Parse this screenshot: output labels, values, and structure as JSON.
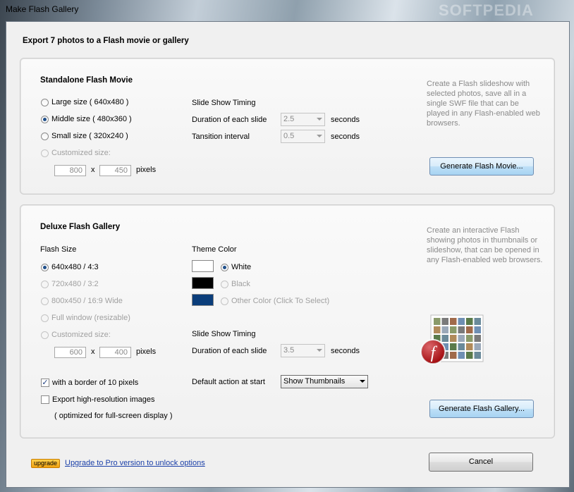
{
  "window": {
    "title": "Make Flash Gallery",
    "watermark": "SOFTPEDIA"
  },
  "header": "Export 7 photos to a Flash movie or gallery",
  "movie": {
    "title": "Standalone Flash Movie",
    "sizes": [
      "Large size ( 640x480 )",
      "Middle size ( 480x360 )",
      "Small size ( 320x240 )",
      "Customized size:"
    ],
    "selected_size": 1,
    "width": "800",
    "height": "450",
    "times_symbol": "x",
    "pixels_label": "pixels",
    "timing_title": "Slide Show Timing",
    "duration_label": "Duration of each slide",
    "duration_value": "2.5",
    "interval_label": "Tansition interval",
    "interval_value": "0.5",
    "seconds_label": "seconds",
    "description": "Create a Flash slideshow with selected photos, save all in a single SWF file that can be played in any Flash-enabled web browsers.",
    "generate_label": "Generate Flash Movie..."
  },
  "gallery": {
    "title": "Deluxe Flash Gallery",
    "size_title": "Flash Size",
    "sizes": [
      "640x480 / 4:3",
      "720x480 / 3:2",
      "800x450 / 16:9 Wide",
      "Full window (resizable)",
      "Customized size:"
    ],
    "selected_size": 0,
    "width": "600",
    "height": "400",
    "times_symbol": "x",
    "pixels_label": "pixels",
    "theme_title": "Theme Color",
    "themes": [
      {
        "label": "White",
        "color": "#ffffff"
      },
      {
        "label": "Black",
        "color": "#000000"
      },
      {
        "label": "Other Color (Click To Select)",
        "color": "#0a3d7a"
      }
    ],
    "selected_theme": 0,
    "timing_title": "Slide Show Timing",
    "duration_label": "Duration of each slide",
    "duration_value": "3.5",
    "seconds_label": "seconds",
    "border_label": "with a border of 10 pixels",
    "border_checked": true,
    "hires_label": "Export high-resolution images",
    "hires_checked": false,
    "hires_note": "( optimized for full-screen display )",
    "action_label": "Default action at start",
    "action_value": "Show Thumbnails",
    "description": "Create an interactive Flash showing photos in thumbnails or slideshow, that can be opened in any Flash-enabled web browsers.",
    "generate_label": "Generate Flash Gallery...",
    "flash_glyph": "f"
  },
  "footer": {
    "badge": "upgrade",
    "upgrade_link": "Upgrade to Pro version to unlock options",
    "cancel_label": "Cancel"
  }
}
